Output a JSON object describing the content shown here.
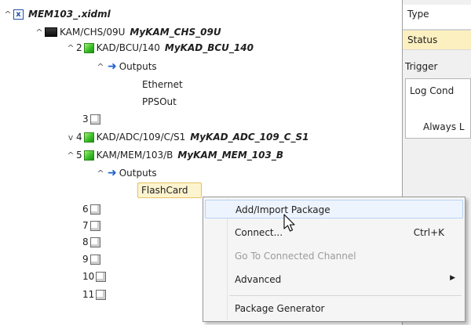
{
  "tree": {
    "root": {
      "label": "MEM103_.xidml"
    },
    "chassis": {
      "label": "KAM/CHS/09U",
      "name": "MyKAM_CHS_09U"
    },
    "slot2": {
      "num": "2",
      "label": "KAD/BCU/140",
      "name": "MyKAD_BCU_140",
      "outputs": {
        "label": "Outputs",
        "items": [
          "Ethernet",
          "PPSOut"
        ]
      }
    },
    "slot3": {
      "num": "3"
    },
    "slot4": {
      "num": "4",
      "label": "KAD/ADC/109/C/S1",
      "name": "MyKAD_ADC_109_C_S1"
    },
    "slot5": {
      "num": "5",
      "label": "KAM/MEM/103/B",
      "name": "MyKAM_MEM_103_B",
      "outputs": {
        "label": "Outputs",
        "selected": "FlashCard"
      }
    },
    "empty_slots": [
      "6",
      "7",
      "8",
      "9",
      "10",
      "11"
    ]
  },
  "side_panel": {
    "type_label": "Type",
    "status_label": "Status",
    "trigger_label": "Trigger",
    "log_cond_label": "Log Cond",
    "always_label": "Always L"
  },
  "context_menu": {
    "items": [
      {
        "label": "Add/Import Package",
        "state": "hover"
      },
      {
        "label": "Connect...",
        "shortcut": "Ctrl+K"
      },
      {
        "label": "Go To Connected Channel",
        "state": "disabled"
      },
      {
        "label": "Advanced",
        "submenu": true
      },
      {
        "label": "Package Generator"
      }
    ]
  },
  "colors": {
    "hover_bg": "#eef4fd",
    "selected_bg": "#fdf3cf",
    "status_bg": "#fdf0c0",
    "arrow_blue": "#1e5fd0"
  },
  "icons": {
    "expanded": "chevron-up-icon",
    "collapsed": "chevron-down-icon",
    "output": "arrow-right-icon"
  }
}
